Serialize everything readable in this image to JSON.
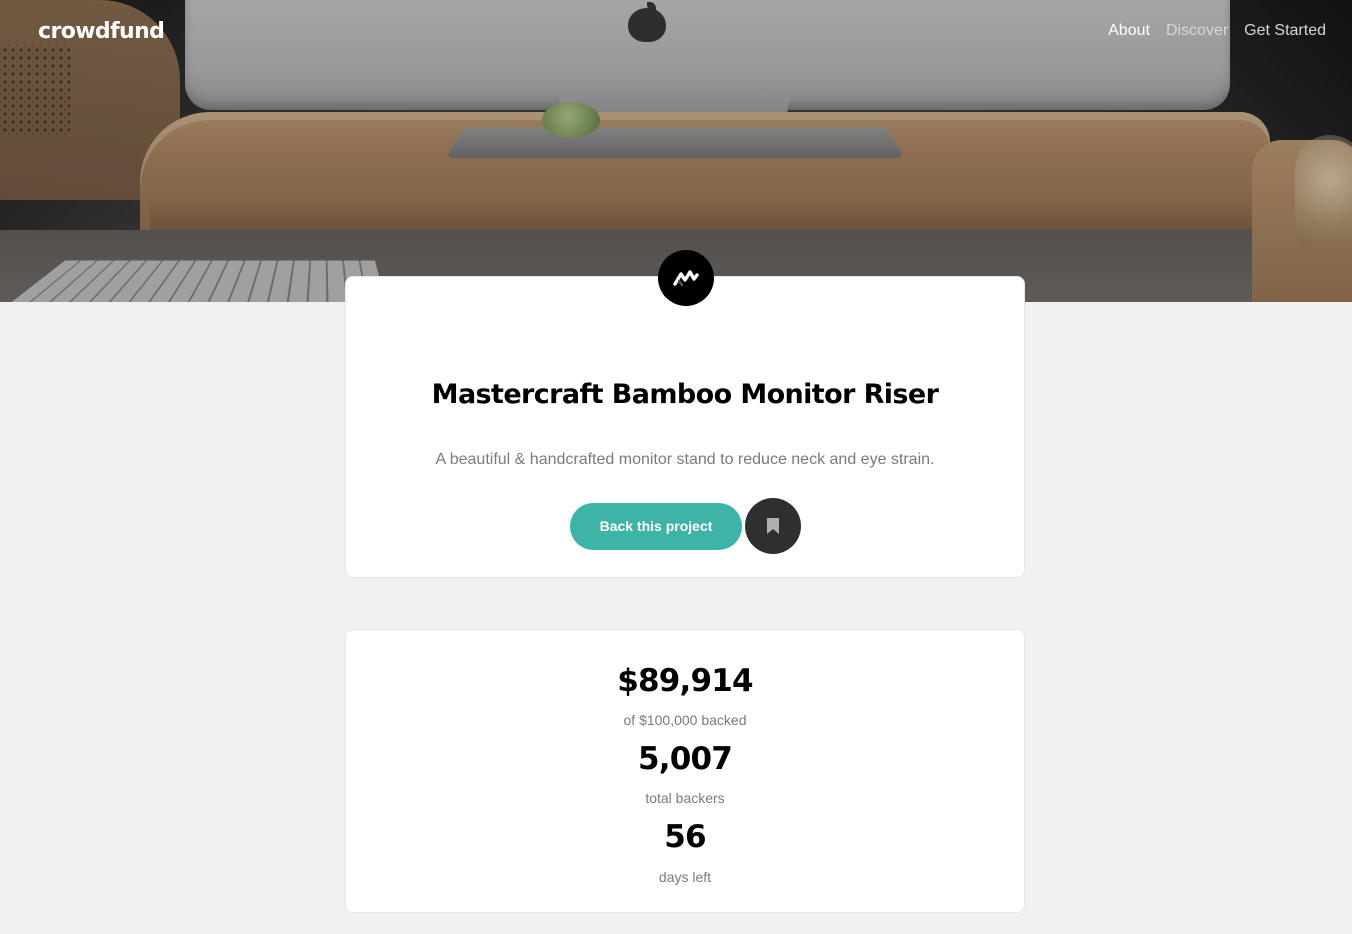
{
  "brand": {
    "name": "crowdfund"
  },
  "nav": {
    "items": [
      {
        "label": "About",
        "active": true
      },
      {
        "label": "Discover",
        "active": false
      },
      {
        "label": "Get Started",
        "active": false
      }
    ]
  },
  "project": {
    "logo_icon": "mastercraft-logo-icon",
    "title": "Mastercraft Bamboo Monitor Riser",
    "tagline": "A beautiful & handcrafted monitor stand to reduce neck and eye strain.",
    "back_button_label": "Back this project",
    "bookmark_icon": "bookmark-icon"
  },
  "stats": {
    "amount": {
      "value": "$89,914",
      "label": "of $100,000 backed"
    },
    "backers": {
      "value": "5,007",
      "label": "total backers"
    },
    "days": {
      "value": "56",
      "label": "days left"
    }
  },
  "colors": {
    "accent": "#3cb4a8",
    "bookmark_bg": "#2f2f2f",
    "background": "#f1f1f1"
  }
}
